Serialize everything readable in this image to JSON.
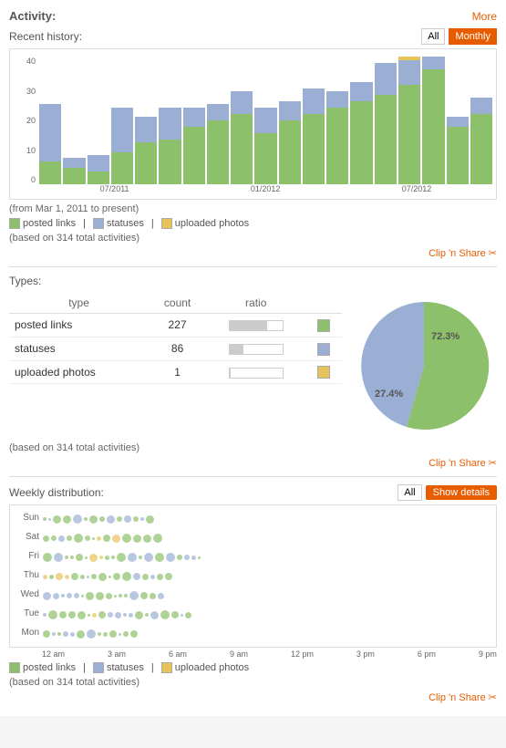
{
  "header": {
    "activity_label": "Activity:",
    "more_label": "More"
  },
  "recent_history": {
    "title": "Recent history:",
    "all_label": "All",
    "monthly_label": "Monthly",
    "from_text": "(from Mar 1, 2011 to present)",
    "based_text": "(based on 314 total activities)",
    "clip_share": "Clip 'n Share",
    "y_axis": [
      "40",
      "30",
      "20",
      "10",
      "0"
    ],
    "x_labels": [
      "07/2011",
      "01/2012",
      "07/2012"
    ],
    "bars": [
      {
        "green": 7,
        "blue": 18,
        "orange": 0
      },
      {
        "green": 5,
        "blue": 3,
        "orange": 0
      },
      {
        "green": 4,
        "blue": 5,
        "orange": 0
      },
      {
        "green": 10,
        "blue": 14,
        "orange": 0
      },
      {
        "green": 13,
        "blue": 8,
        "orange": 0
      },
      {
        "green": 14,
        "blue": 10,
        "orange": 0
      },
      {
        "green": 18,
        "blue": 6,
        "orange": 0
      },
      {
        "green": 20,
        "blue": 5,
        "orange": 0
      },
      {
        "green": 22,
        "blue": 7,
        "orange": 0
      },
      {
        "green": 16,
        "blue": 8,
        "orange": 0
      },
      {
        "green": 20,
        "blue": 6,
        "orange": 0
      },
      {
        "green": 22,
        "blue": 8,
        "orange": 0
      },
      {
        "green": 24,
        "blue": 5,
        "orange": 0
      },
      {
        "green": 26,
        "blue": 6,
        "orange": 0
      },
      {
        "green": 28,
        "blue": 10,
        "orange": 0
      },
      {
        "green": 32,
        "blue": 8,
        "orange": 1
      },
      {
        "green": 36,
        "blue": 4,
        "orange": 0
      },
      {
        "green": 18,
        "blue": 3,
        "orange": 0
      },
      {
        "green": 22,
        "blue": 5,
        "orange": 0
      }
    ],
    "legend": [
      {
        "label": "posted links",
        "color": "#8dc06a"
      },
      {
        "label": "statuses",
        "color": "#9bafd4"
      },
      {
        "label": "uploaded photos",
        "color": "#e8c35a"
      }
    ]
  },
  "types": {
    "title": "Types:",
    "based_text": "(based on 314 total activities)",
    "clip_share": "Clip 'n Share",
    "columns": [
      "type",
      "count",
      "ratio",
      ""
    ],
    "rows": [
      {
        "type": "posted links",
        "count": "227",
        "ratio_pct": 72,
        "color": "#8dc06a"
      },
      {
        "type": "statuses",
        "count": "86",
        "ratio_pct": 27,
        "color": "#9bafd4"
      },
      {
        "type": "uploaded photos",
        "count": "1",
        "ratio_pct": 1,
        "color": "#e8c35a"
      }
    ],
    "pie": {
      "large_label": "72.3%",
      "small_label": "27.4%",
      "large_color": "#8dc06a",
      "small_color": "#9bafd4"
    }
  },
  "weekly": {
    "title": "Weekly distribution:",
    "all_label": "All",
    "show_details_label": "Show details",
    "based_text": "(based on 314 total activities)",
    "clip_share": "Clip 'n Share",
    "x_labels": [
      "12 am",
      "3 am",
      "6 am",
      "9 am",
      "12 pm",
      "3 pm",
      "6 pm",
      "9 pm"
    ],
    "days": [
      "Sun",
      "Sat",
      "Fri",
      "Thu",
      "Wed",
      "Tue",
      "Mon"
    ],
    "legend": [
      {
        "label": "posted links",
        "color": "#8dc06a"
      },
      {
        "label": "statuses",
        "color": "#9bafd4"
      },
      {
        "label": "uploaded photos",
        "color": "#e8c35a"
      }
    ]
  }
}
